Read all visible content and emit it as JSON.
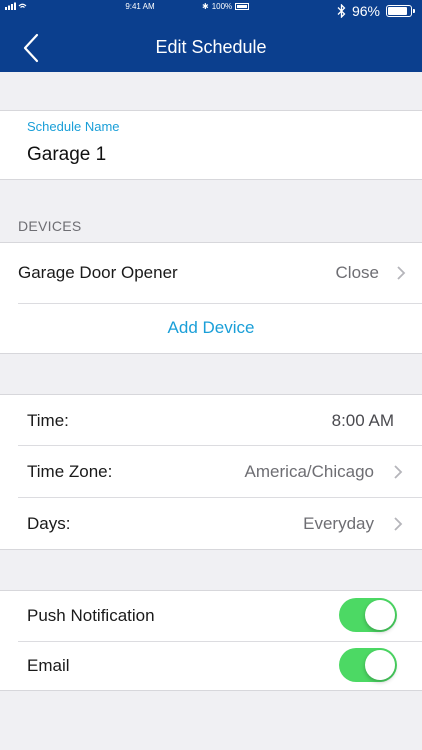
{
  "status_bar": {
    "time": "9:41 AM",
    "small_battery": "100%",
    "battery": "96%"
  },
  "nav": {
    "title": "Edit Schedule"
  },
  "schedule": {
    "name_label": "Schedule Name",
    "name_value": "Garage 1"
  },
  "devices": {
    "section_title": "DEVICES",
    "items": [
      {
        "name": "Garage Door Opener",
        "action": "Close"
      }
    ],
    "add_label": "Add Device"
  },
  "timing": {
    "time_label": "Time:",
    "time_value": "8:00 AM",
    "zone_label": "Time Zone:",
    "zone_value": "America/Chicago",
    "days_label": "Days:",
    "days_value": "Everyday"
  },
  "notifications": {
    "push_label": "Push Notification",
    "push_on": true,
    "email_label": "Email",
    "email_on": true
  },
  "colors": {
    "nav": "#0b3f8e",
    "accent": "#1a9fd8",
    "toggle_on": "#4cd964"
  }
}
